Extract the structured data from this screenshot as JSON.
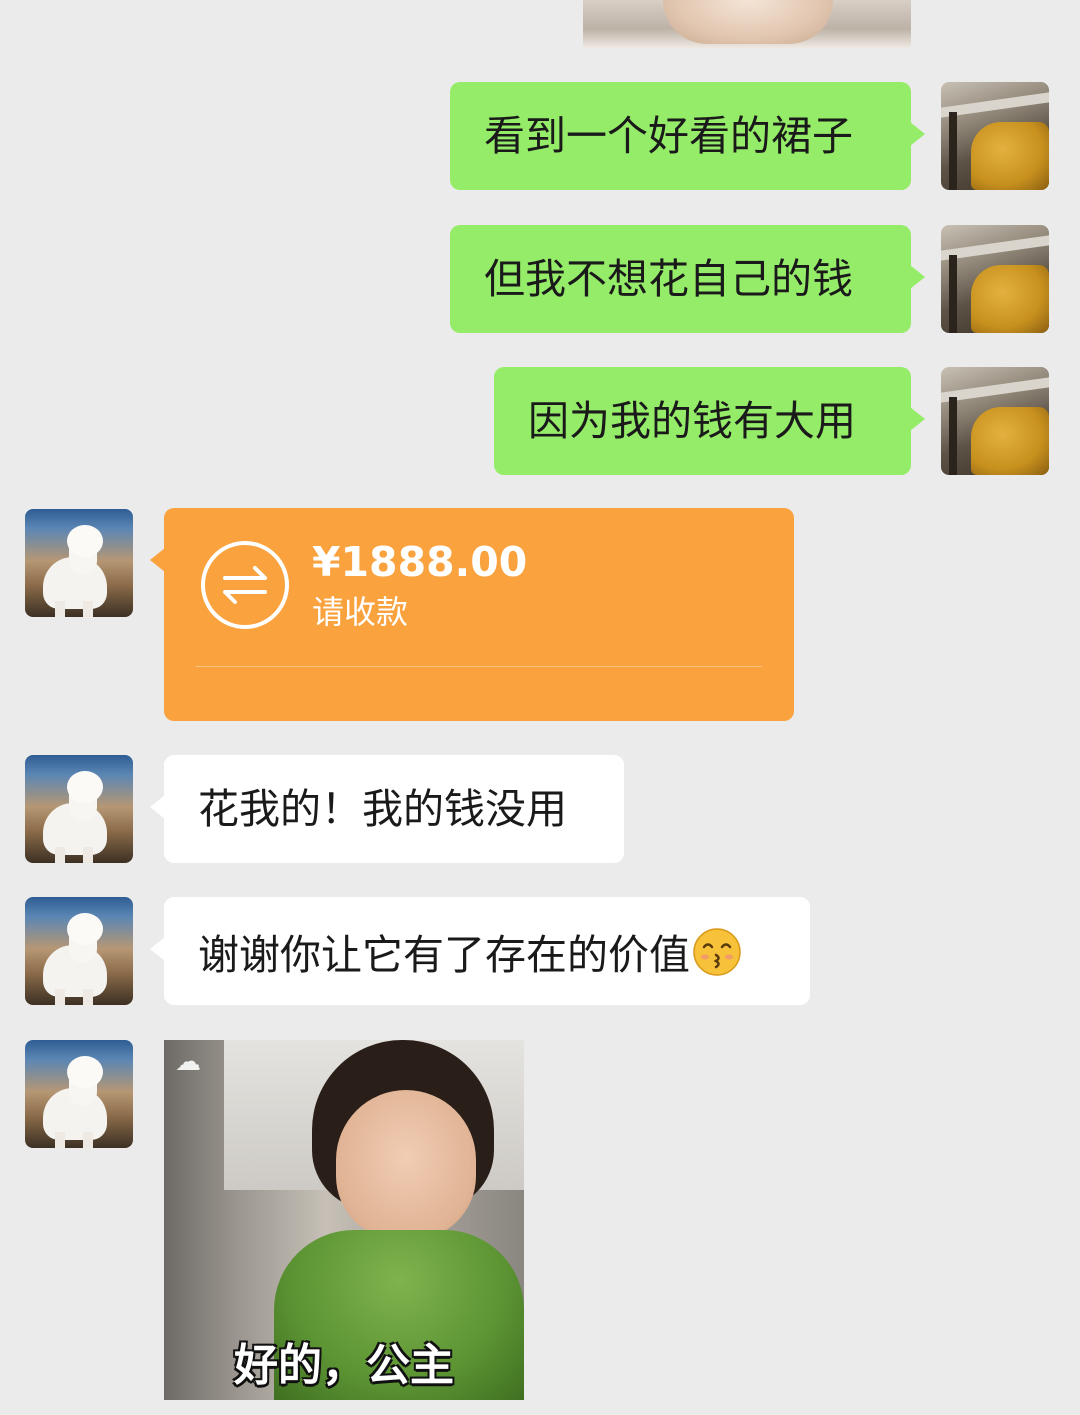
{
  "messages": {
    "sent": [
      {
        "text": "看到一个好看的裙子"
      },
      {
        "text": "但我不想花自己的钱"
      },
      {
        "text": "因为我的钱有大用"
      }
    ],
    "transfer": {
      "amount": "¥1888.00",
      "status": "请收款"
    },
    "received": [
      {
        "text": "花我的！我的钱没用"
      },
      {
        "text": "谢谢你让它有了存在的价值"
      }
    ],
    "sticker": {
      "caption": "好的，公主"
    }
  },
  "colors": {
    "sent_bubble": "#95ec69",
    "received_bubble": "#ffffff",
    "transfer_card": "#f9a23e",
    "background": "#ebebeb"
  },
  "icons": {
    "transfer": "transfer-arrows-icon",
    "emoji": "kissing-face-icon"
  }
}
